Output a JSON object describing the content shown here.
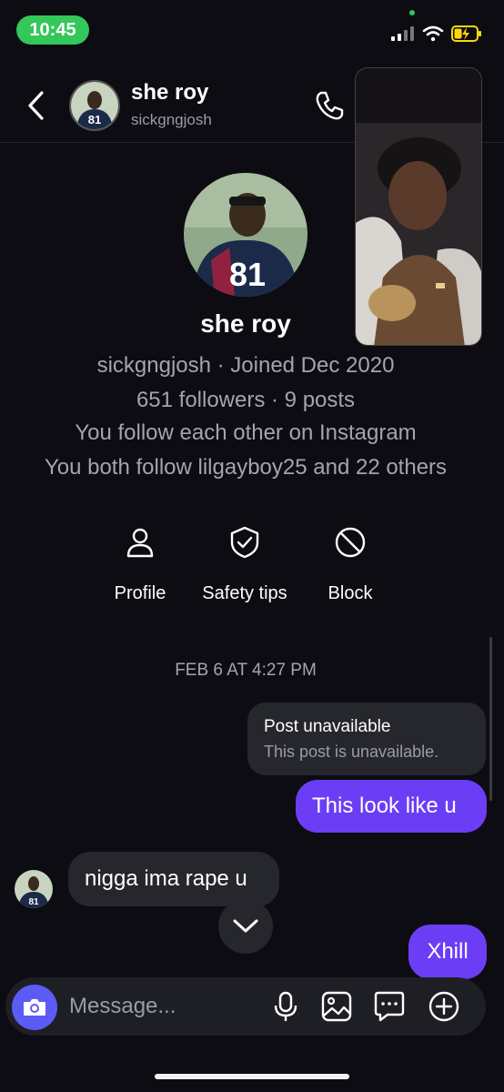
{
  "status_bar": {
    "time": "10:45"
  },
  "header": {
    "name": "she roy",
    "username": "sickgngjosh"
  },
  "profile": {
    "name": "she roy",
    "line1": "sickgngjosh · Joined Dec 2020",
    "line2": "651 followers · 9 posts",
    "line3": "You follow each other on Instagram",
    "line4": "You both follow lilgayboy25 and 22 others",
    "jersey_number": "81"
  },
  "actions": {
    "profile": "Profile",
    "safety": "Safety tips",
    "block": "Block"
  },
  "thread": {
    "date": "FEB 6 AT 4:27 PM",
    "post_title": "Post unavailable",
    "post_sub": "This post is unavailable.",
    "sent_1": "This look like u",
    "received_1": "nigga ima rape u",
    "sent_2": "Xhill"
  },
  "composer": {
    "placeholder": "Message..."
  },
  "colors": {
    "accent": "#6b3ef5",
    "status_green": "#34c759",
    "camera": "#5b5bf6"
  }
}
